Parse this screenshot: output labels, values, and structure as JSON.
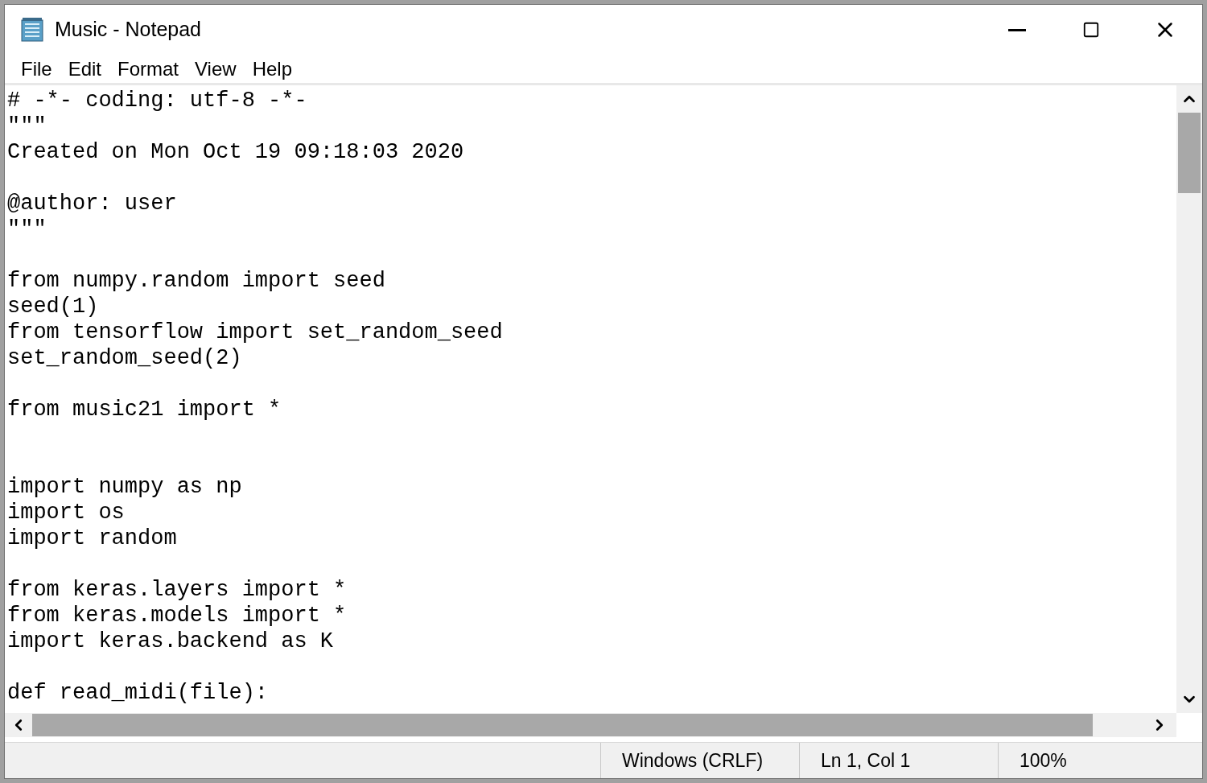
{
  "window": {
    "title": "Music - Notepad"
  },
  "menu": [
    "File",
    "Edit",
    "Format",
    "View",
    "Help"
  ],
  "lines": [
    {
      "kind": "text",
      "text": "# -*- coding: utf-8 -*-"
    },
    {
      "kind": "text",
      "text": "\"\"\""
    },
    {
      "kind": "text",
      "text": "Created on Mon Oct 19 09:18:03 2020"
    },
    {
      "kind": "blank"
    },
    {
      "kind": "text",
      "text": "@author: user"
    },
    {
      "kind": "text",
      "text": "\"\"\""
    },
    {
      "kind": "blank"
    },
    {
      "kind": "text",
      "text": "from numpy.random import seed"
    },
    {
      "kind": "text",
      "text": "seed(1)"
    },
    {
      "kind": "text",
      "text": "from tensorflow import set_random_seed"
    },
    {
      "kind": "text",
      "text": "set_random_seed(2)"
    },
    {
      "kind": "blank"
    },
    {
      "kind": "text",
      "text": "from music21 import *"
    },
    {
      "kind": "blank"
    },
    {
      "kind": "blank"
    },
    {
      "kind": "text",
      "text": "import numpy as np"
    },
    {
      "kind": "text",
      "text": "import os"
    },
    {
      "kind": "text",
      "text": "import random"
    },
    {
      "kind": "blank"
    },
    {
      "kind": "text",
      "text": "from keras.layers import *"
    },
    {
      "kind": "text",
      "text": "from keras.models import *"
    },
    {
      "kind": "text",
      "text": "import keras.backend as K"
    },
    {
      "kind": "blank"
    },
    {
      "kind": "text",
      "text": "def read_midi(file):"
    }
  ],
  "status_bar": [
    "Windows (CRLF)",
    "Ln 1, Col 1",
    "100%"
  ]
}
